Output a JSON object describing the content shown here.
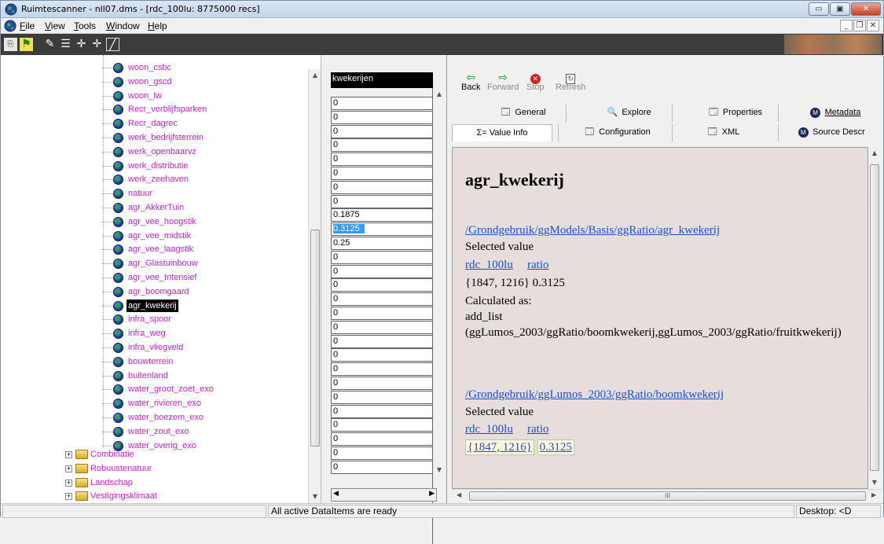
{
  "window": {
    "title": "Ruimtescanner - nll07.dms - [rdc_100lu: 8775000 recs]",
    "buttons": {
      "minimize": "▭",
      "maximize": "▣",
      "close": "✕"
    }
  },
  "menu": {
    "items": [
      {
        "label": "File",
        "key": "F"
      },
      {
        "label": "View",
        "key": "V"
      },
      {
        "label": "Tools",
        "key": "T"
      },
      {
        "label": "Window",
        "key": "W"
      },
      {
        "label": "Help",
        "key": "H"
      }
    ],
    "mdi": {
      "minimize": "_",
      "restore": "❐",
      "close": "✕"
    }
  },
  "toolbar": {
    "icons": [
      "copy-icon",
      "runner-icon",
      "brush-icon",
      "list-indent-icon",
      "crosshair-icon",
      "crosshair-add-icon",
      "line-icon"
    ]
  },
  "tree": {
    "items": [
      {
        "label": "woon_csbc"
      },
      {
        "label": "woon_gscd"
      },
      {
        "label": "woon_lw"
      },
      {
        "label": "Recr_verblijfsparken"
      },
      {
        "label": "Recr_dagrec"
      },
      {
        "label": "werk_bedrijfsterrein"
      },
      {
        "label": "werk_openbaarvz"
      },
      {
        "label": "werk_distributie"
      },
      {
        "label": "werk_zeehaven"
      },
      {
        "label": "natuur"
      },
      {
        "label": "agr_AkkerTuin"
      },
      {
        "label": "agr_vee_hoogstik"
      },
      {
        "label": "agr_vee_midstik"
      },
      {
        "label": "agr_vee_laagstik"
      },
      {
        "label": "agr_Glastuinbouw"
      },
      {
        "label": "agr_vee_Intensief"
      },
      {
        "label": "agr_boomgaard"
      },
      {
        "label": "agr_kwekerij",
        "selected": true
      },
      {
        "label": "infra_spoor"
      },
      {
        "label": "infra_weg"
      },
      {
        "label": "infra_vliegveld"
      },
      {
        "label": "bouwterrein"
      },
      {
        "label": "buitenland"
      },
      {
        "label": "water_groot_zoet_exo"
      },
      {
        "label": "water_rivieren_exo"
      },
      {
        "label": "water_boezem_exo"
      },
      {
        "label": "water_zout_exo"
      },
      {
        "label": "water_overig_exo"
      }
    ],
    "folders": [
      {
        "label": "Combinatie",
        "pm": "+"
      },
      {
        "label": "Robuustenatuur",
        "pm": "+"
      },
      {
        "label": "Landschap",
        "pm": "+"
      },
      {
        "label": "Vestigingsklimaat",
        "pm": "+"
      }
    ]
  },
  "value_column": {
    "header": "kwekerijen",
    "values": [
      "0",
      "0",
      "0",
      "0",
      "0",
      "0",
      "0",
      "0",
      "0.1875",
      "0.3125",
      "0.25",
      "0",
      "0",
      "0",
      "0",
      "0",
      "0",
      "0",
      "0",
      "0",
      "0",
      "0",
      "0",
      "0",
      "0",
      "0",
      "0"
    ],
    "highlighted_index": 9
  },
  "nav": {
    "back": {
      "label": "Back",
      "key": "B"
    },
    "forward": {
      "label": "Forward",
      "key": "o"
    },
    "stop": {
      "label": "Stop",
      "key": "S"
    },
    "refresh": {
      "label": "Refresh",
      "key": "R"
    }
  },
  "tabs_row1": [
    {
      "label": "General",
      "key": "G",
      "icon": "properties-icon"
    },
    {
      "label": "Explore",
      "icon": "explore-icon"
    },
    {
      "label": "Properties",
      "key": "P",
      "icon": "properties-icon"
    },
    {
      "label": "Metadata",
      "key": "M",
      "icon": "metadata-icon"
    }
  ],
  "tabs_row2": [
    {
      "label": "Value Info",
      "prefix": "Σ=",
      "key": "V",
      "active": true
    },
    {
      "label": "Configuration",
      "key": "C",
      "icon": "properties-icon"
    },
    {
      "label": "XML",
      "key": "X",
      "icon": "properties-icon"
    },
    {
      "label": "Source Descr",
      "icon": "metadata-icon"
    }
  ],
  "content": {
    "heading": "agr_kwekerij",
    "link1": "/Grondgebruik/ggModels/Basis/ggRatio/agr_kwekerij",
    "selected_value_label": "Selected value",
    "col1": "rdc_100lu",
    "col2": "ratio",
    "row1": "{1847, 1216} 0.3125",
    "calculated_as": "Calculated as:",
    "expr_name": "add_list",
    "expr_args": "(ggLumos_2003/ggRatio/boomkwekerij,ggLumos_2003/ggRatio/fruitkwekerij)",
    "link2": "/Grondgebruik/ggLumos_2003/ggRatio/boomkwekerij",
    "selected_value_label2": "Selected value",
    "col1b": "rdc_100lu",
    "col2b": "ratio",
    "row2_coord": "{1847, 1216}",
    "row2_value": "0.3125",
    "hscroll_mark": "III"
  },
  "status": {
    "message": "All active DataItems are ready",
    "desktop": "Desktop: <D"
  }
}
